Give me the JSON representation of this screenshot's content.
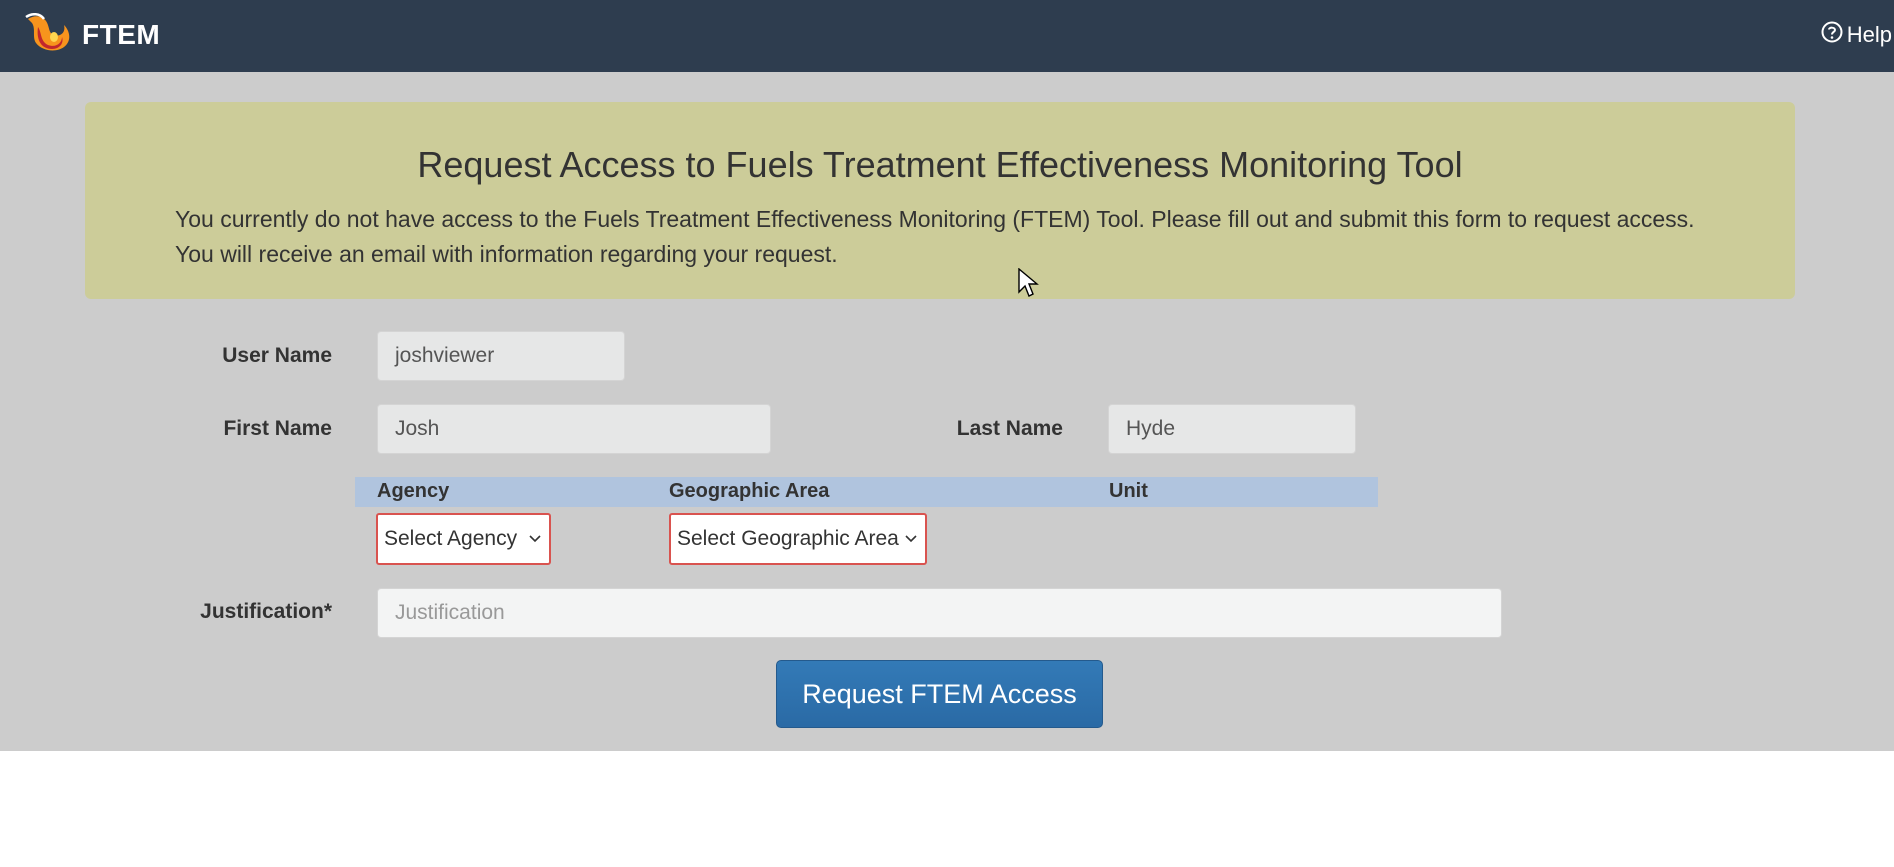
{
  "navbar": {
    "brand": "FTEM",
    "help_label": "Help"
  },
  "banner": {
    "title": "Request Access to Fuels Treatment Effectiveness Monitoring Tool",
    "text": "You currently do not have access to the Fuels Treatment Effectiveness Monitoring (FTEM) Tool. Please fill out and submit this form to request access. You will receive an email with information regarding your request."
  },
  "form": {
    "username_label": "User Name",
    "username_value": "joshviewer",
    "firstname_label": "First Name",
    "firstname_value": "Josh",
    "lastname_label": "Last Name",
    "lastname_value": "Hyde",
    "agency_header": "Agency",
    "geo_header": "Geographic Area",
    "unit_header": "Unit",
    "agency_select": "Select Agency",
    "geo_select": "Select Geographic Area",
    "justification_label": "Justification*",
    "justification_placeholder": "Justification",
    "submit_label": "Request FTEM Access"
  },
  "colors": {
    "navbar": "#2e3d4f",
    "banner": "#cccc99",
    "content_bg": "#cccccc",
    "org_header_bar": "#b0c4de",
    "select_error_border": "#d9534f",
    "primary_button": "#337ab7"
  },
  "icons": {
    "brand": "flame-logo-icon",
    "help": "question-circle-icon",
    "select": "chevron-down-icon"
  }
}
